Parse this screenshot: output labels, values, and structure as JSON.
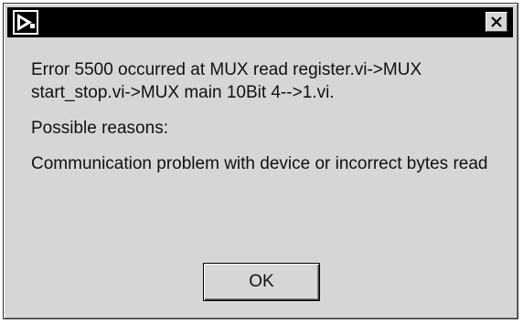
{
  "window": {
    "title": "",
    "app_icon": "labview-vi-icon",
    "close_icon": "close-icon",
    "close_glyph": "✕"
  },
  "dialog": {
    "error_message": "Error 5500 occurred at MUX read register.vi->MUX start_stop.vi->MUX main 10Bit 4-->1.vi.",
    "reasons_heading": "Possible reasons:",
    "reason_detail": "Communication problem with device or incorrect bytes read",
    "ok_label": "OK"
  },
  "colors": {
    "titlebar": "#000000",
    "dialog_background": "#d6d6d6",
    "text": "#111111"
  }
}
